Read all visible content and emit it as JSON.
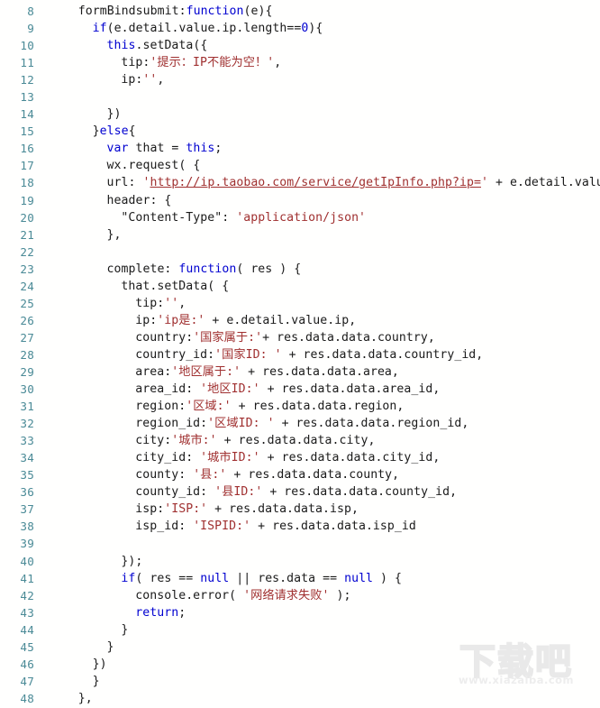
{
  "editor": {
    "language": "javascript",
    "background_color": "#fffffe",
    "gutter_color": "#4a8a96",
    "first_line_number": 8,
    "last_line_number": 48,
    "total_lines_shown": 41
  },
  "syntax_colors": {
    "keyword": "#0000d0",
    "string": "#a03030",
    "url_string": "#a03030",
    "plain": "#1a1a1a",
    "line_number": "#4a8a96"
  },
  "watermark": {
    "glyphs": "下载吧",
    "url": "www.xiazaiba.com"
  },
  "lines": [
    {
      "n": "8",
      "indent": 4,
      "tokens": [
        {
          "t": "formBindsubmit:",
          "c": "plain"
        },
        {
          "t": "function",
          "c": "kw"
        },
        {
          "t": "(e){",
          "c": "plain"
        }
      ]
    },
    {
      "n": "9",
      "indent": 6,
      "tokens": [
        {
          "t": "if",
          "c": "kw"
        },
        {
          "t": "(e.detail.value.ip.length==",
          "c": "plain"
        },
        {
          "t": "0",
          "c": "kw"
        },
        {
          "t": "){",
          "c": "plain"
        }
      ]
    },
    {
      "n": "10",
      "indent": 8,
      "tokens": [
        {
          "t": "this",
          "c": "kw"
        },
        {
          "t": ".setData({",
          "c": "plain"
        }
      ]
    },
    {
      "n": "11",
      "indent": 10,
      "tokens": [
        {
          "t": "tip:",
          "c": "plain"
        },
        {
          "t": "'提示：IP不能为空！'",
          "c": "str"
        },
        {
          "t": ",",
          "c": "plain"
        }
      ]
    },
    {
      "n": "12",
      "indent": 10,
      "tokens": [
        {
          "t": "ip:",
          "c": "plain"
        },
        {
          "t": "''",
          "c": "str"
        },
        {
          "t": ",",
          "c": "plain"
        }
      ]
    },
    {
      "n": "13",
      "indent": 0,
      "tokens": []
    },
    {
      "n": "14",
      "indent": 8,
      "tokens": [
        {
          "t": "})",
          "c": "plain"
        }
      ]
    },
    {
      "n": "15",
      "indent": 6,
      "tokens": [
        {
          "t": "}",
          "c": "plain"
        },
        {
          "t": "else",
          "c": "kw"
        },
        {
          "t": "{",
          "c": "plain"
        }
      ]
    },
    {
      "n": "16",
      "indent": 8,
      "tokens": [
        {
          "t": "var",
          "c": "kw"
        },
        {
          "t": " that = ",
          "c": "plain"
        },
        {
          "t": "this",
          "c": "kw"
        },
        {
          "t": ";",
          "c": "plain"
        }
      ]
    },
    {
      "n": "17",
      "indent": 8,
      "tokens": [
        {
          "t": "wx.request( {",
          "c": "plain"
        }
      ]
    },
    {
      "n": "18",
      "indent": 8,
      "tokens": [
        {
          "t": "url: ",
          "c": "plain"
        },
        {
          "t": "'",
          "c": "str"
        },
        {
          "t": "http://ip.taobao.com/service/getIpInfo.php?ip=",
          "c": "url"
        },
        {
          "t": "'",
          "c": "str"
        },
        {
          "t": " + e.detail.value.ip,",
          "c": "plain"
        }
      ]
    },
    {
      "n": "19",
      "indent": 8,
      "tokens": [
        {
          "t": "header: {",
          "c": "plain"
        }
      ]
    },
    {
      "n": "20",
      "indent": 10,
      "tokens": [
        {
          "t": "\"Content-Type\"",
          "c": "plain"
        },
        {
          "t": ": ",
          "c": "plain"
        },
        {
          "t": "'application/json'",
          "c": "str"
        }
      ]
    },
    {
      "n": "21",
      "indent": 8,
      "tokens": [
        {
          "t": "},",
          "c": "plain"
        }
      ]
    },
    {
      "n": "22",
      "indent": 0,
      "tokens": []
    },
    {
      "n": "23",
      "indent": 8,
      "tokens": [
        {
          "t": "complete: ",
          "c": "plain"
        },
        {
          "t": "function",
          "c": "kw"
        },
        {
          "t": "( res ) {",
          "c": "plain"
        }
      ]
    },
    {
      "n": "24",
      "indent": 10,
      "tokens": [
        {
          "t": "that.setData( {",
          "c": "plain"
        }
      ]
    },
    {
      "n": "25",
      "indent": 12,
      "tokens": [
        {
          "t": "tip:",
          "c": "plain"
        },
        {
          "t": "''",
          "c": "str"
        },
        {
          "t": ",",
          "c": "plain"
        }
      ]
    },
    {
      "n": "26",
      "indent": 12,
      "tokens": [
        {
          "t": "ip:",
          "c": "plain"
        },
        {
          "t": "'ip是:'",
          "c": "str"
        },
        {
          "t": " + e.detail.value.ip,",
          "c": "plain"
        }
      ]
    },
    {
      "n": "27",
      "indent": 12,
      "tokens": [
        {
          "t": "country:",
          "c": "plain"
        },
        {
          "t": "'国家属于:'",
          "c": "str"
        },
        {
          "t": "+ res.data.data.country,",
          "c": "plain"
        }
      ]
    },
    {
      "n": "28",
      "indent": 12,
      "tokens": [
        {
          "t": "country_id:",
          "c": "plain"
        },
        {
          "t": "'国家ID: '",
          "c": "str"
        },
        {
          "t": " + res.data.data.country_id,",
          "c": "plain"
        }
      ]
    },
    {
      "n": "29",
      "indent": 12,
      "tokens": [
        {
          "t": "area:",
          "c": "plain"
        },
        {
          "t": "'地区属于:'",
          "c": "str"
        },
        {
          "t": " + res.data.data.area,",
          "c": "plain"
        }
      ]
    },
    {
      "n": "30",
      "indent": 12,
      "tokens": [
        {
          "t": "area_id: ",
          "c": "plain"
        },
        {
          "t": "'地区ID:'",
          "c": "str"
        },
        {
          "t": " + res.data.data.area_id,",
          "c": "plain"
        }
      ]
    },
    {
      "n": "31",
      "indent": 12,
      "tokens": [
        {
          "t": "region:",
          "c": "plain"
        },
        {
          "t": "'区域:'",
          "c": "str"
        },
        {
          "t": " + res.data.data.region,",
          "c": "plain"
        }
      ]
    },
    {
      "n": "32",
      "indent": 12,
      "tokens": [
        {
          "t": "region_id:",
          "c": "plain"
        },
        {
          "t": "'区域ID: '",
          "c": "str"
        },
        {
          "t": " + res.data.data.region_id,",
          "c": "plain"
        }
      ]
    },
    {
      "n": "33",
      "indent": 12,
      "tokens": [
        {
          "t": "city:",
          "c": "plain"
        },
        {
          "t": "'城市:'",
          "c": "str"
        },
        {
          "t": " + res.data.data.city,",
          "c": "plain"
        }
      ]
    },
    {
      "n": "34",
      "indent": 12,
      "tokens": [
        {
          "t": "city_id: ",
          "c": "plain"
        },
        {
          "t": "'城市ID:'",
          "c": "str"
        },
        {
          "t": " + res.data.data.city_id,",
          "c": "plain"
        }
      ]
    },
    {
      "n": "35",
      "indent": 12,
      "tokens": [
        {
          "t": "county: ",
          "c": "plain"
        },
        {
          "t": "'县:'",
          "c": "str"
        },
        {
          "t": " + res.data.data.county,",
          "c": "plain"
        }
      ]
    },
    {
      "n": "36",
      "indent": 12,
      "tokens": [
        {
          "t": "county_id: ",
          "c": "plain"
        },
        {
          "t": "'县ID:'",
          "c": "str"
        },
        {
          "t": " + res.data.data.county_id,",
          "c": "plain"
        }
      ]
    },
    {
      "n": "37",
      "indent": 12,
      "tokens": [
        {
          "t": "isp:",
          "c": "plain"
        },
        {
          "t": "'ISP:'",
          "c": "str"
        },
        {
          "t": " + res.data.data.isp,",
          "c": "plain"
        }
      ]
    },
    {
      "n": "38",
      "indent": 12,
      "tokens": [
        {
          "t": "isp_id: ",
          "c": "plain"
        },
        {
          "t": "'ISPID:'",
          "c": "str"
        },
        {
          "t": " + res.data.data.isp_id",
          "c": "plain"
        }
      ]
    },
    {
      "n": "39",
      "indent": 0,
      "tokens": []
    },
    {
      "n": "40",
      "indent": 10,
      "tokens": [
        {
          "t": "});",
          "c": "plain"
        }
      ]
    },
    {
      "n": "41",
      "indent": 10,
      "tokens": [
        {
          "t": "if",
          "c": "kw"
        },
        {
          "t": "( res == ",
          "c": "plain"
        },
        {
          "t": "null",
          "c": "kw"
        },
        {
          "t": " || res.data == ",
          "c": "plain"
        },
        {
          "t": "null",
          "c": "kw"
        },
        {
          "t": " ) {",
          "c": "plain"
        }
      ]
    },
    {
      "n": "42",
      "indent": 12,
      "tokens": [
        {
          "t": "console.error( ",
          "c": "plain"
        },
        {
          "t": "'网络请求失败'",
          "c": "str"
        },
        {
          "t": " );",
          "c": "plain"
        }
      ]
    },
    {
      "n": "43",
      "indent": 12,
      "tokens": [
        {
          "t": "return",
          "c": "kw"
        },
        {
          "t": ";",
          "c": "plain"
        }
      ]
    },
    {
      "n": "44",
      "indent": 10,
      "tokens": [
        {
          "t": "}",
          "c": "plain"
        }
      ]
    },
    {
      "n": "45",
      "indent": 8,
      "tokens": [
        {
          "t": "}",
          "c": "plain"
        }
      ]
    },
    {
      "n": "46",
      "indent": 6,
      "tokens": [
        {
          "t": "})",
          "c": "plain"
        }
      ]
    },
    {
      "n": "47",
      "indent": 6,
      "tokens": [
        {
          "t": "}",
          "c": "plain"
        }
      ]
    },
    {
      "n": "48",
      "indent": 4,
      "tokens": [
        {
          "t": "},",
          "c": "plain"
        }
      ]
    }
  ]
}
